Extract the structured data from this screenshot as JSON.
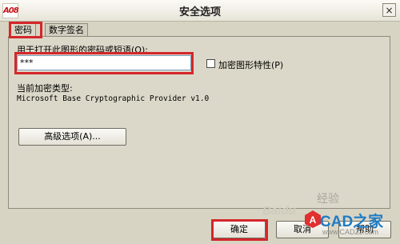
{
  "window": {
    "title": "安全选项",
    "app_icon": "A08",
    "close_glyph": "×"
  },
  "tabs": [
    {
      "label": "密码",
      "active": true
    },
    {
      "label": "数字签名",
      "active": false
    }
  ],
  "password_section": {
    "prompt": "用于打开此图形的密码或短语(O):",
    "value": "***",
    "encrypt_properties_label": "加密图形特性(P)",
    "encrypt_properties_checked": false
  },
  "encryption": {
    "label": "当前加密类型:",
    "provider": "Microsoft Base Cryptographic Provider v1.0"
  },
  "buttons": {
    "advanced": "高级选项(A)...",
    "ok": "确定",
    "cancel": "取消",
    "help": "帮助"
  },
  "watermark": {
    "site": "CAD之家",
    "baidu": "Baidu",
    "jingyan": "经验",
    "url": "www.CADZJ.com",
    "logo_letter": "A"
  },
  "colors": {
    "highlight": "#d4272a",
    "brand": "#1f7cc4"
  }
}
